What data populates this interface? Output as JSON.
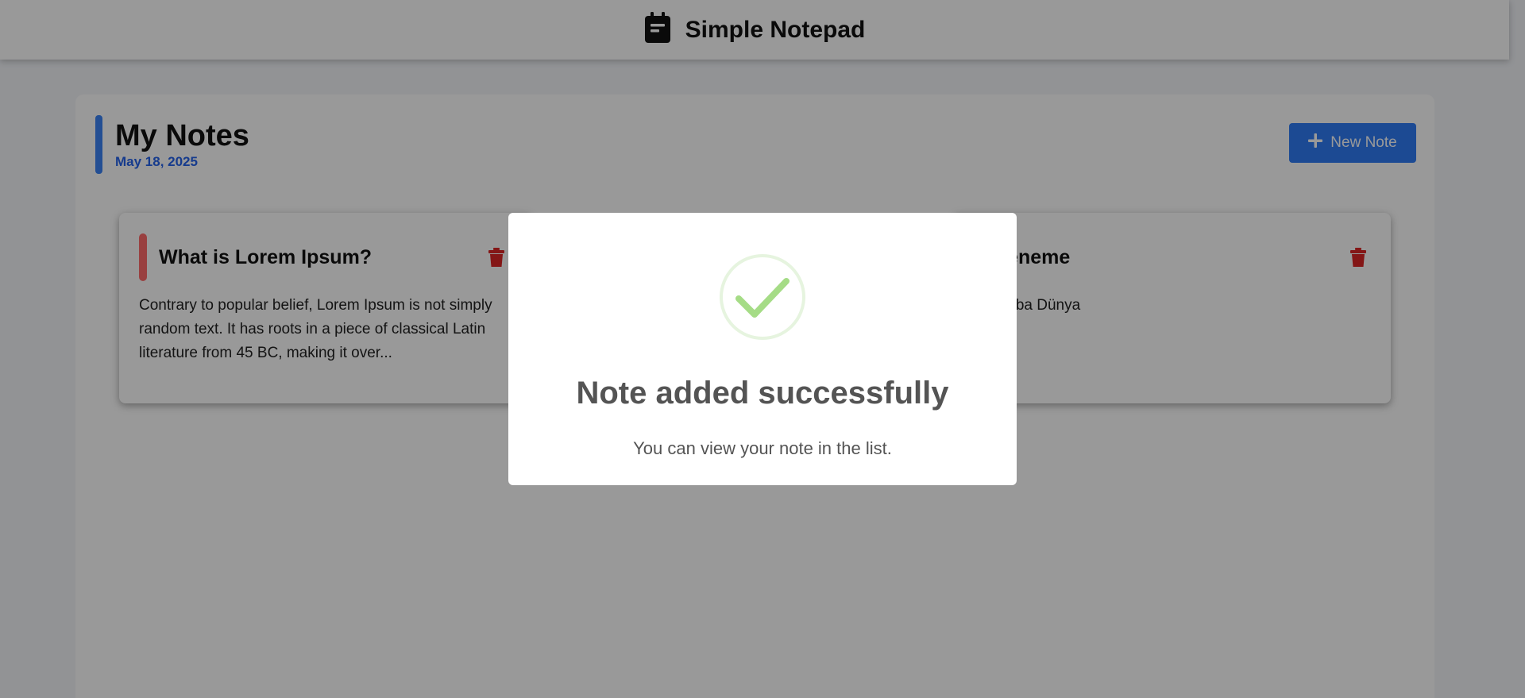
{
  "app": {
    "title": "Simple Notepad",
    "icon": "notepad-icon"
  },
  "main": {
    "heading": "My Notes",
    "date": "May 18, 2025",
    "new_note_label": "New Note",
    "new_note_icon": "plus-icon"
  },
  "notes": [
    {
      "title": "What is Lorem Ipsum?",
      "body": "Contrary to popular belief, Lorem Ipsum is not simply random text. It has roots in a piece of classical Latin literature from 45 BC, making it over...",
      "delete_icon": "trash-icon"
    },
    {
      "title": "Deneme",
      "body": "Merhaba Dünya",
      "delete_icon": "trash-icon"
    }
  ],
  "modal": {
    "icon": "success-check-icon",
    "title": "Note added successfully",
    "text": "You can view your note in the list."
  },
  "colors": {
    "primary": "#2f7cf6",
    "accent_blue": "#3b82f6",
    "date_blue": "#2563eb",
    "note_accent": "#ff6b6b",
    "delete_red": "#dc2626",
    "success_green": "#a5dc86"
  }
}
